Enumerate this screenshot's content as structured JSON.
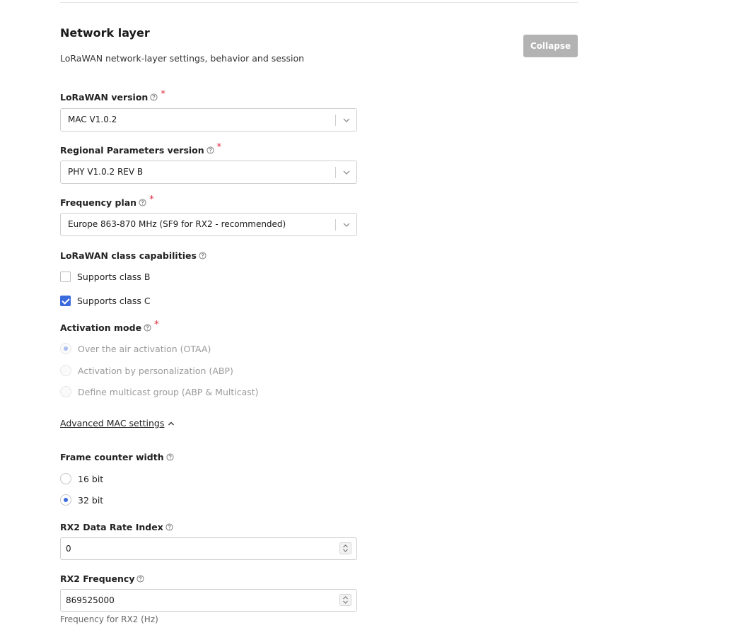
{
  "section": {
    "title": "Network layer",
    "description": "LoRaWAN network-layer settings, behavior and session",
    "collapse_label": "Collapse"
  },
  "lorawan_version": {
    "label": "LoRaWAN version",
    "required": "*",
    "value": "MAC V1.0.2"
  },
  "regional_params": {
    "label": "Regional Parameters version",
    "required": "*",
    "value": "PHY V1.0.2 REV B"
  },
  "frequency_plan": {
    "label": "Frequency plan",
    "required": "*",
    "value": "Europe 863-870 MHz (SF9 for RX2 - recommended)"
  },
  "class_capabilities": {
    "label": "LoRaWAN class capabilities",
    "options": [
      {
        "label": "Supports class B",
        "checked": false
      },
      {
        "label": "Supports class C",
        "checked": true
      }
    ]
  },
  "activation_mode": {
    "label": "Activation mode",
    "required": "*",
    "disabled": true,
    "options": [
      {
        "label": "Over the air activation (OTAA)",
        "selected": true
      },
      {
        "label": "Activation by personalization (ABP)",
        "selected": false
      },
      {
        "label": "Define multicast group (ABP & Multicast)",
        "selected": false
      }
    ]
  },
  "advanced": {
    "label": "Advanced MAC settings"
  },
  "frame_counter": {
    "label": "Frame counter width",
    "options": [
      {
        "label": "16 bit",
        "selected": false
      },
      {
        "label": "32 bit",
        "selected": true
      }
    ]
  },
  "rx2_data_rate": {
    "label": "RX2 Data Rate Index",
    "value": "0"
  },
  "rx2_frequency": {
    "label": "RX2 Frequency",
    "value": "869525000",
    "hint": "Frequency for RX2 (Hz)"
  },
  "colors": {
    "accent": "#3b6bdc",
    "required": "#e0283e",
    "collapse_button_bg": "#b3b3b3"
  }
}
